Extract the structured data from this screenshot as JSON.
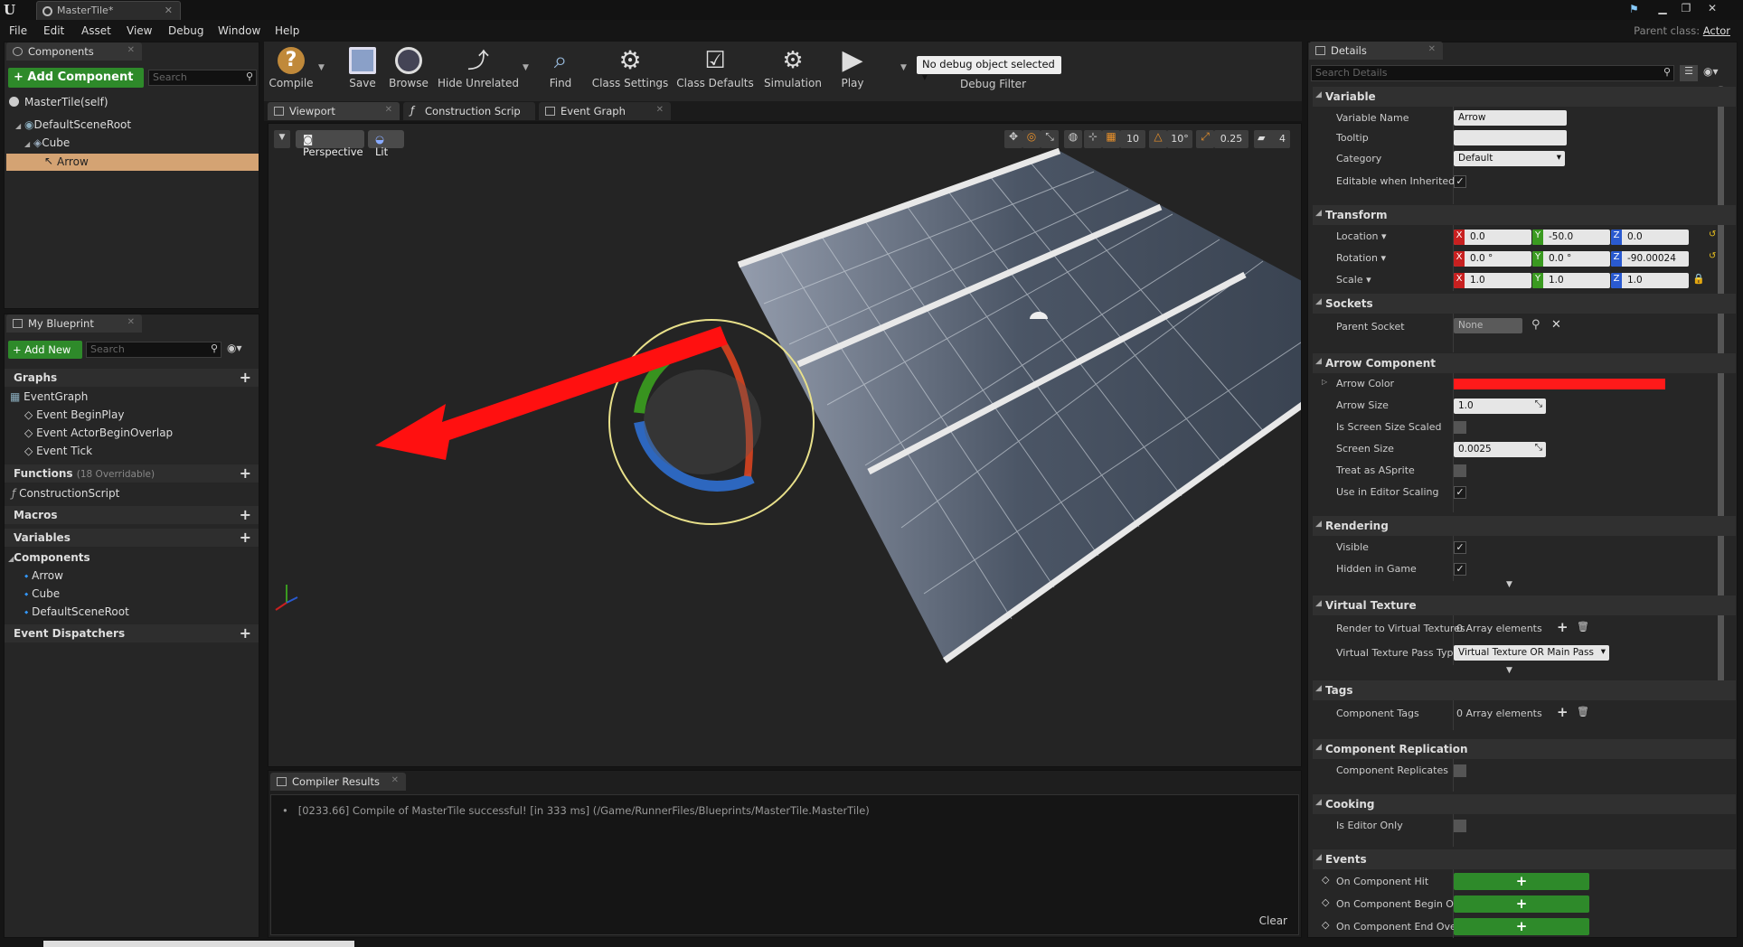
{
  "window": {
    "tab_title": "MasterTile*",
    "logo": "U",
    "parent_class_label": "Parent class:",
    "parent_class_value": "Actor"
  },
  "menu": [
    "File",
    "Edit",
    "Asset",
    "View",
    "Debug",
    "Window",
    "Help"
  ],
  "components_panel": {
    "title": "Components",
    "add_button": "+ Add Component",
    "search_placeholder": "Search",
    "self_item": "MasterTile(self)",
    "tree": [
      "DefaultSceneRoot",
      "Cube",
      "Arrow"
    ]
  },
  "my_blueprint": {
    "title": "My Blueprint",
    "add_button": "+ Add New",
    "search_placeholder": "Search",
    "graphs_label": "Graphs",
    "event_graph": "EventGraph",
    "events": [
      "Event BeginPlay",
      "Event ActorBeginOverlap",
      "Event Tick"
    ],
    "functions_label": "Functions",
    "functions_note": "(18 Overridable)",
    "construction_script": "ConstructionScript",
    "macros_label": "Macros",
    "variables_label": "Variables",
    "components_label": "Components",
    "component_vars": [
      "Arrow",
      "Cube",
      "DefaultSceneRoot"
    ],
    "dispatchers_label": "Event Dispatchers"
  },
  "toolbar": {
    "compile": "Compile",
    "save": "Save",
    "browse": "Browse",
    "hide_unrelated": "Hide Unrelated",
    "find": "Find",
    "class_settings": "Class Settings",
    "class_defaults": "Class Defaults",
    "simulation": "Simulation",
    "play": "Play",
    "debug_select": "No debug object selected",
    "debug_filter": "Debug Filter"
  },
  "editor_tabs": [
    "Viewport",
    "Construction Scrip",
    "Event Graph"
  ],
  "viewport": {
    "perspective": "Perspective",
    "lit": "Lit",
    "grid_snap": "10",
    "rot_snap": "10°",
    "scale_snap": "0.25",
    "cam_speed": "4"
  },
  "compiler": {
    "title": "Compiler Results",
    "message": "[0233.66] Compile of MasterTile successful! [in 333 ms] (/Game/RunnerFiles/Blueprints/MasterTile.MasterTile)",
    "clear": "Clear"
  },
  "details": {
    "title": "Details",
    "search_placeholder": "Search Details",
    "variable": {
      "section": "Variable",
      "name_label": "Variable Name",
      "name_value": "Arrow",
      "tooltip_label": "Tooltip",
      "category_label": "Category",
      "category_value": "Default",
      "editable_label": "Editable when Inherited"
    },
    "transform": {
      "section": "Transform",
      "location_label": "Location",
      "rotation_label": "Rotation",
      "scale_label": "Scale",
      "location": [
        "0.0",
        "-50.0",
        "0.0"
      ],
      "rotation": [
        "0.0 °",
        "0.0 °",
        "-90.00024"
      ],
      "scale": [
        "1.0",
        "1.0",
        "1.0"
      ]
    },
    "sockets": {
      "section": "Sockets",
      "parent_label": "Parent Socket",
      "parent_value": "None"
    },
    "arrow": {
      "section": "Arrow Component",
      "color_label": "Arrow Color",
      "color": "#ff1a1a",
      "size_label": "Arrow Size",
      "size_value": "1.0",
      "screen_scaled_label": "Is Screen Size Scaled",
      "screen_size_label": "Screen Size",
      "screen_size_value": "0.0025",
      "sprite_label": "Treat as ASprite",
      "editor_scaling_label": "Use in Editor Scaling"
    },
    "rendering": {
      "section": "Rendering",
      "visible_label": "Visible",
      "hidden_label": "Hidden in Game"
    },
    "vt": {
      "section": "Virtual Texture",
      "render_label": "Render to Virtual Textures",
      "render_value": "0 Array elements",
      "pass_label": "Virtual Texture Pass Type",
      "pass_value": "Virtual Texture OR Main Pass"
    },
    "tags": {
      "section": "Tags",
      "label": "Component Tags",
      "value": "0 Array elements"
    },
    "replication": {
      "section": "Component Replication",
      "label": "Component Replicates"
    },
    "cooking": {
      "section": "Cooking",
      "label": "Is Editor Only"
    },
    "events": {
      "section": "Events",
      "items": [
        "On Component Hit",
        "On Component Begin Ov",
        "On Component End Over"
      ]
    }
  },
  "colors": {
    "accent_green": "#2e8a2a",
    "selection": "#d4a373",
    "axis_x": "#c82020",
    "axis_y": "#3a9a20",
    "axis_z": "#2a5ad0"
  }
}
